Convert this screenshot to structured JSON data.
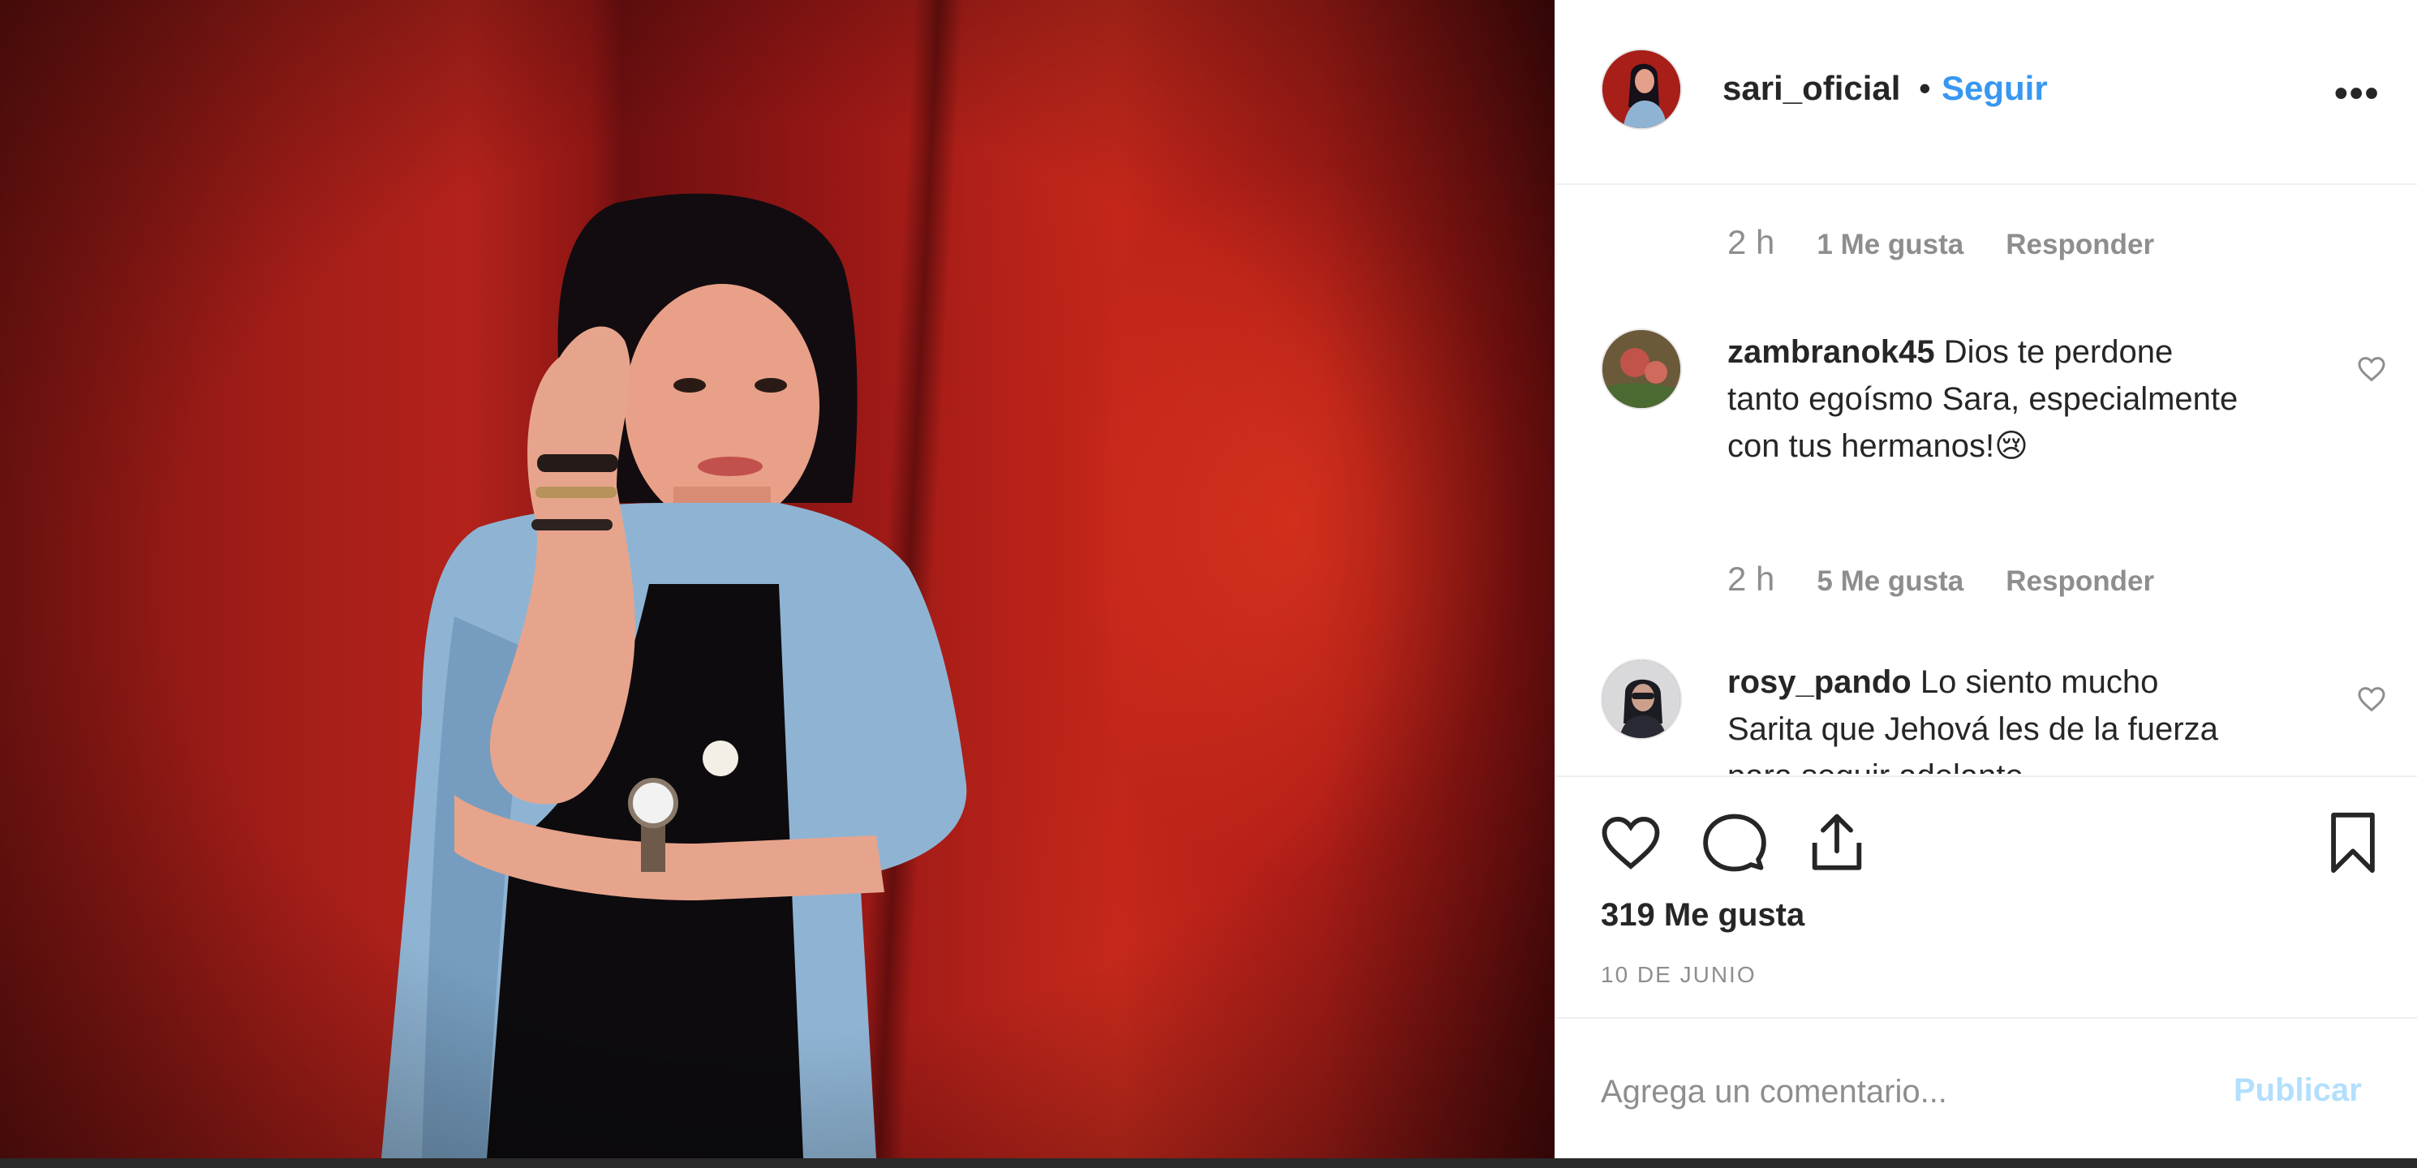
{
  "post": {
    "author": "sari_oficial",
    "separator": "•",
    "follow_label": "Seguir",
    "more_label": "•••"
  },
  "comments": {
    "top_meta": {
      "time": "2 h",
      "likes": "1 Me gusta",
      "reply": "Responder"
    },
    "items": [
      {
        "user": "zambranok45",
        "text": "Dios te perdone tanto egoísmo Sara, especialmente con tus hermanos!😢",
        "time": "2 h",
        "likes": "5 Me gusta",
        "reply": "Responder"
      },
      {
        "user": "rosy_pando",
        "text": "Lo siento mucho Sarita que Jehová les de la fuerza para seguir adelante"
      }
    ]
  },
  "actions": {
    "like_icon": "heart-icon",
    "comment_icon": "comment-bubble-icon",
    "share_icon": "share-icon",
    "save_icon": "bookmark-icon",
    "likes_count": "319 Me gusta",
    "date": "10 DE JUNIO"
  },
  "composer": {
    "placeholder": "Agrega un comentario...",
    "publish_label": "Publicar"
  },
  "colors": {
    "accent": "#3897f0",
    "publish_disabled": "#b2dffc",
    "muted_text": "#8e8e8e"
  }
}
